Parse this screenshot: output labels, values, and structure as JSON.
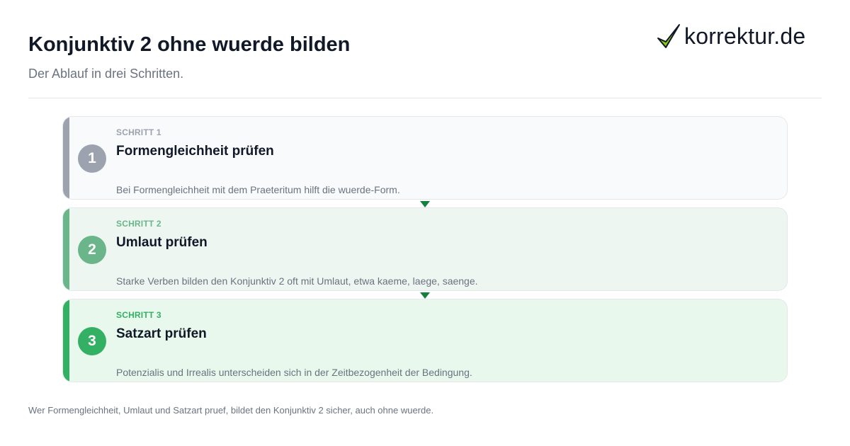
{
  "header": {
    "title": "Konjunktiv 2 ohne wuerde bilden",
    "subtitle": "Der Ablauf in drei Schritten."
  },
  "logo": {
    "text": "korrektur.de",
    "icon": "checkmark-icon"
  },
  "steps": [
    {
      "number": "1",
      "kicker": "SCHRITT 1",
      "title": "Formengleichheit prüfen",
      "description": "Bei Formengleichheit mit dem Praeteritum hilft die wuerde-Form.",
      "accent": "#9ca3af",
      "background": "#f8fafc"
    },
    {
      "number": "2",
      "kicker": "SCHRITT 2",
      "title": "Umlaut prüfen",
      "description": "Starke Verben bilden den Konjunktiv 2 oft mit Umlaut, etwa kaeme, laege, saenge.",
      "accent": "#6bb58b",
      "background": "#eef6f1"
    },
    {
      "number": "3",
      "kicker": "SCHRITT 3",
      "title": "Satzart prüfen",
      "description": "Potenzialis und Irrealis unterscheiden sich in der Zeitbezogenheit der Bedingung.",
      "accent": "#34b064",
      "background": "#e8f8ec"
    }
  ],
  "connector_color": "#15803d",
  "footnote": "Wer Formengleichheit, Umlaut und Satzart pruef, bildet den Konjunktiv 2 sicher, auch ohne wuerde."
}
